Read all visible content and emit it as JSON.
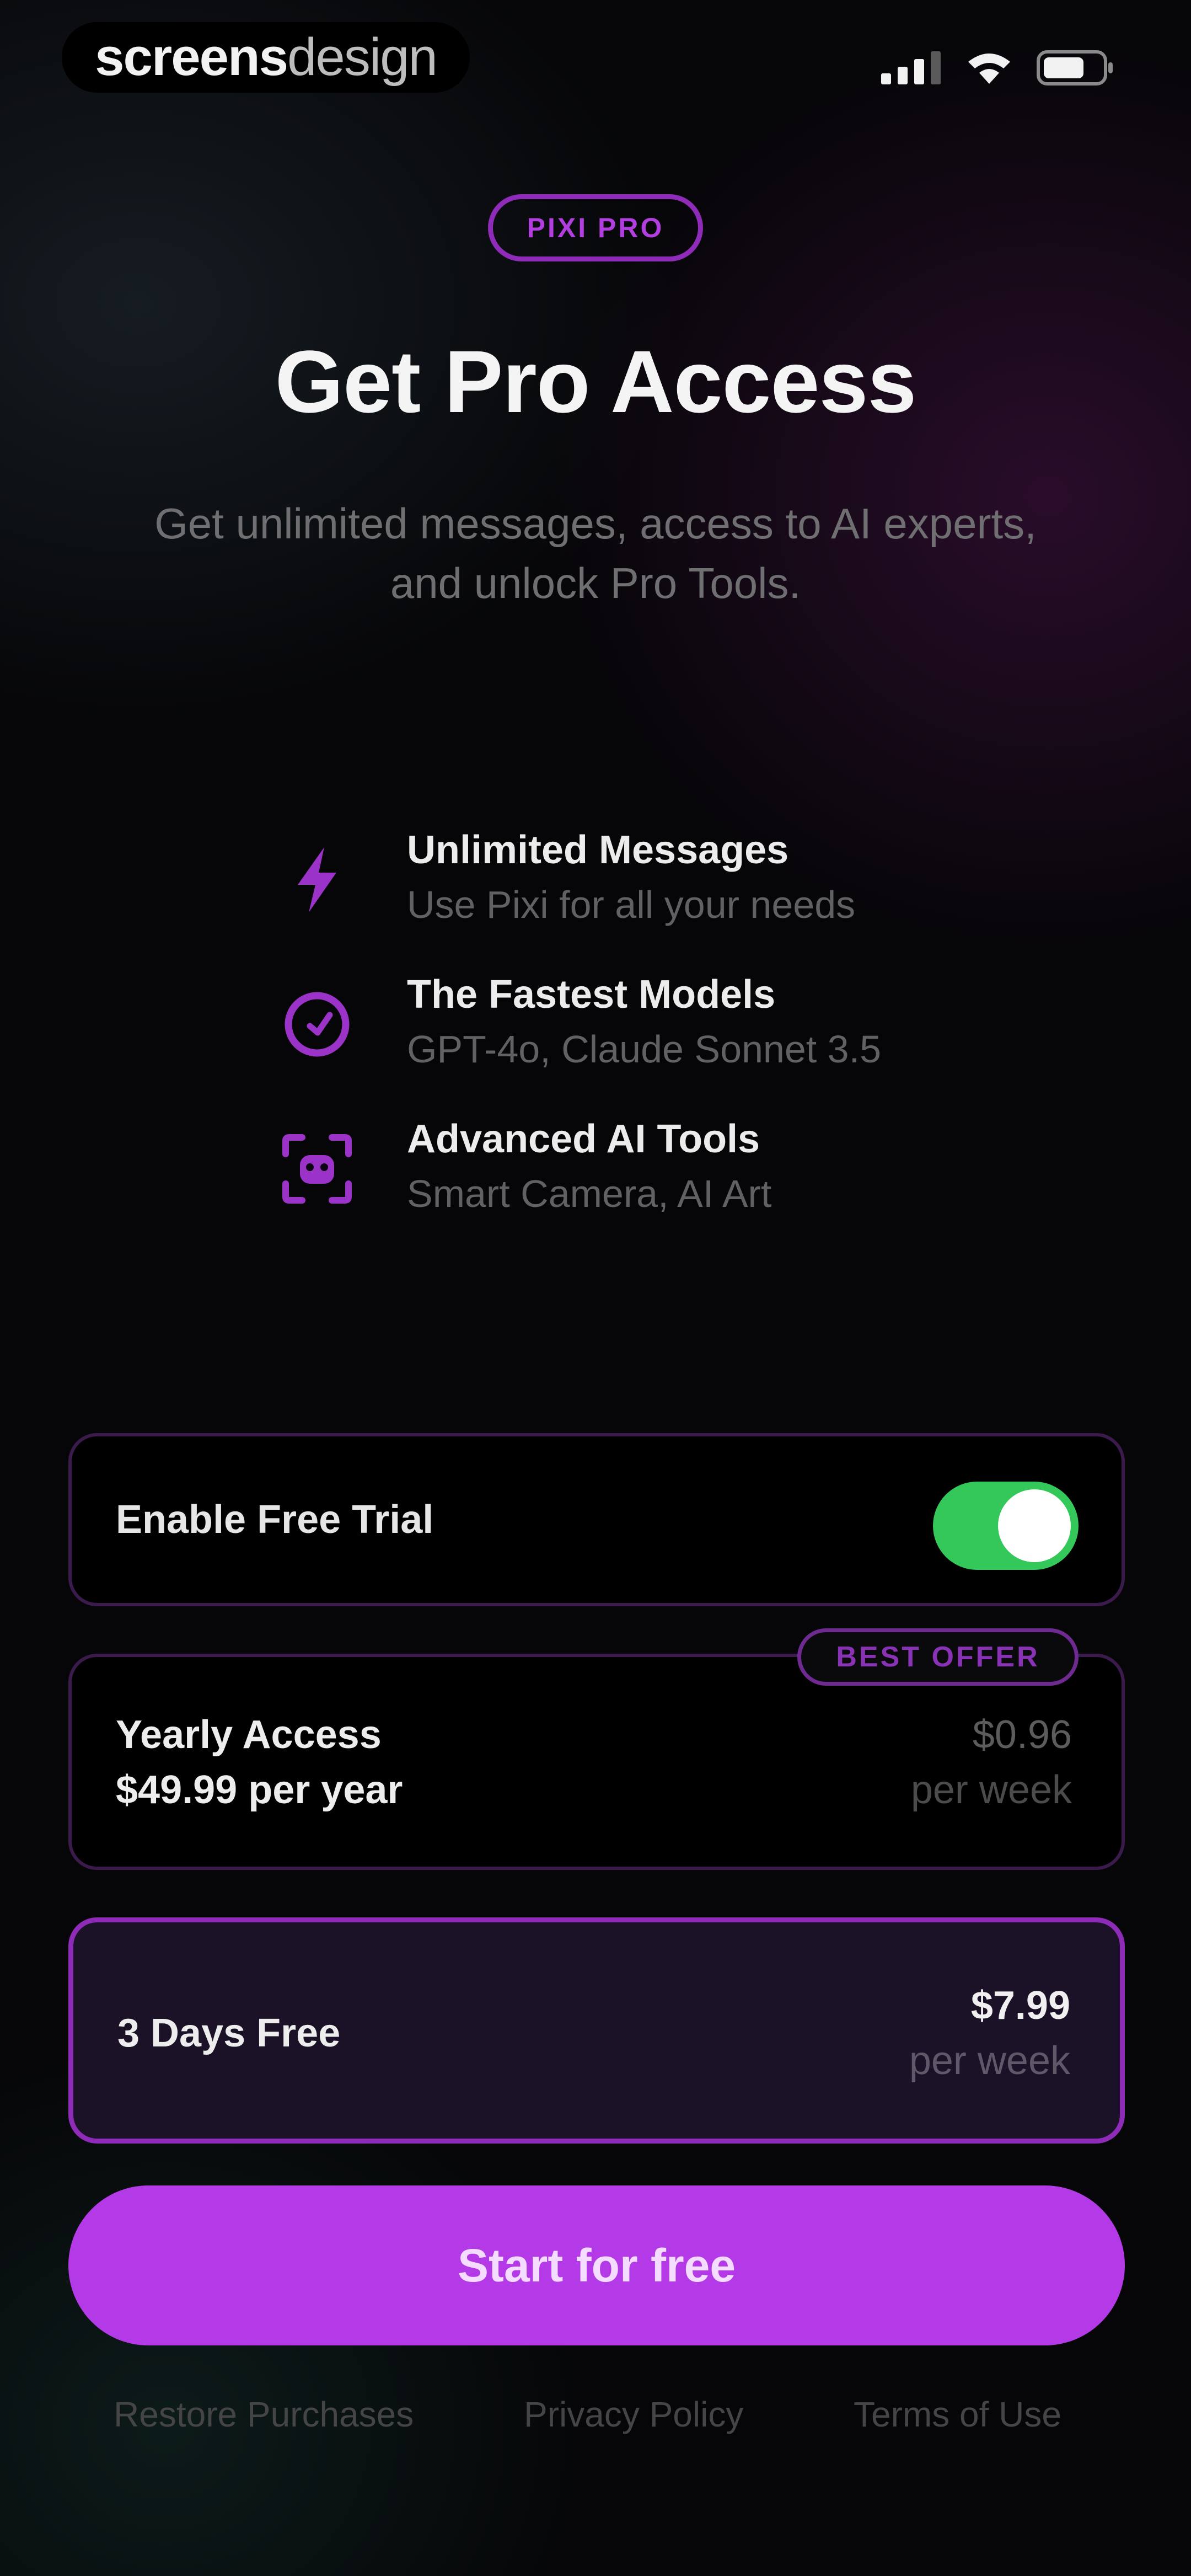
{
  "status_bar": {
    "brand_part1": "screens",
    "brand_part2": "design",
    "icons": [
      "signal-icon",
      "wifi-icon",
      "battery-icon"
    ]
  },
  "header": {
    "pill": "PIXI PRO",
    "title": "Get Pro Access",
    "subtitle_line1": "Get unlimited messages, access to AI experts,",
    "subtitle_line2": "and unlock Pro Tools."
  },
  "features": [
    {
      "icon": "lightning-icon",
      "title": "Unlimited Messages",
      "desc": "Use Pixi for all your needs"
    },
    {
      "icon": "speedometer-icon",
      "title": "The Fastest Models",
      "desc": "GPT-4o, Claude Sonnet 3.5"
    },
    {
      "icon": "scan-face-icon",
      "title": "Advanced AI Tools",
      "desc": "Smart Camera, AI Art"
    }
  ],
  "trial": {
    "label": "Enable Free Trial",
    "enabled": true
  },
  "plans": {
    "yearly": {
      "badge": "BEST OFFER",
      "name": "Yearly Access",
      "price": "$49.99 per year",
      "weekly_price": "$0.96",
      "weekly_unit": "per week"
    },
    "weekly": {
      "name": "3 Days Free",
      "price": "$7.99",
      "unit": "per week",
      "selected": true
    }
  },
  "cta": {
    "label": "Start for free"
  },
  "footer": {
    "restore": "Restore Purchases",
    "privacy": "Privacy Policy",
    "terms": "Terms of Use"
  },
  "colors": {
    "accent": "#b53ae7",
    "toggle_on": "#34c759",
    "background": "#060608"
  }
}
